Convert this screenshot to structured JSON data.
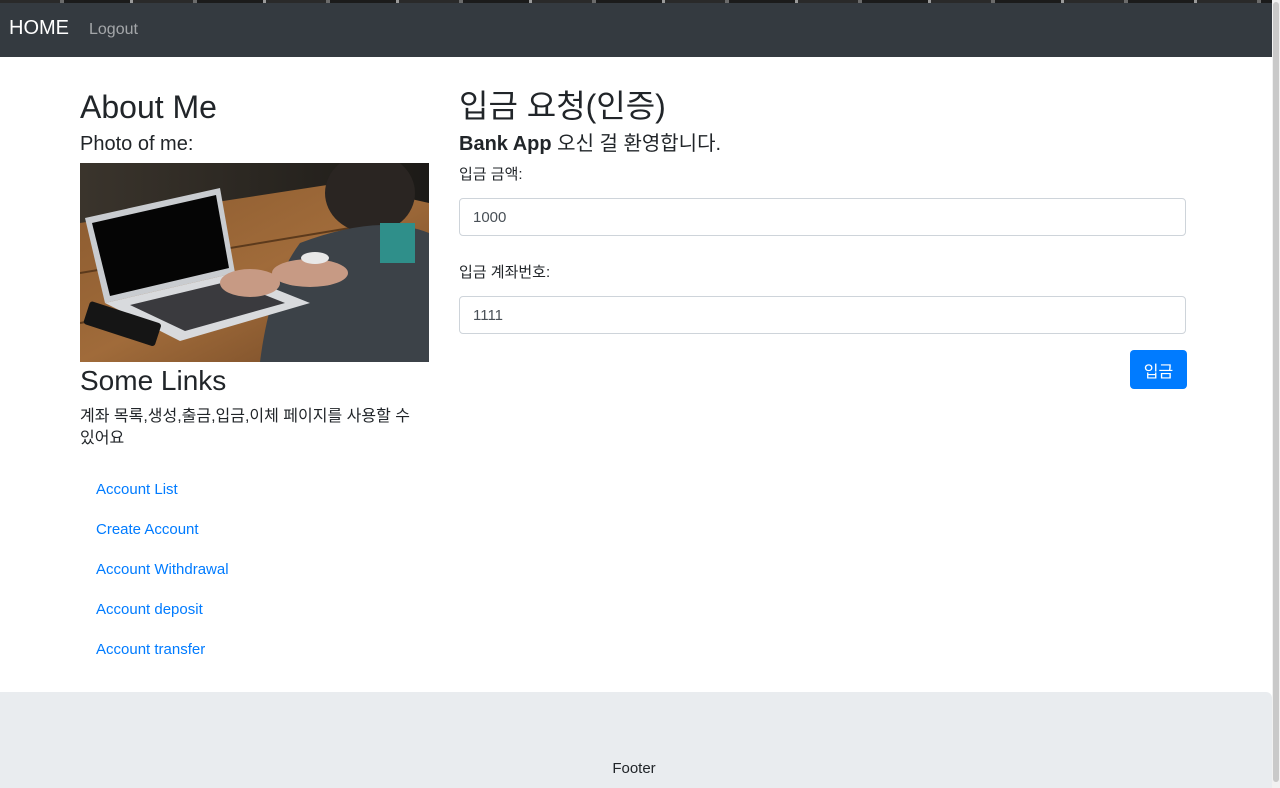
{
  "navbar": {
    "brand": "HOME",
    "links": [
      {
        "label": "Logout"
      }
    ]
  },
  "sidebar": {
    "title": "About Me",
    "photo_label": "Photo of me:",
    "photo_icon": "laptop-photo",
    "links_title": "Some Links",
    "links_description": "계좌 목록,생성,출금,입금,이체 페이지를 사용할 수 있어요",
    "links": [
      {
        "label": "Account List"
      },
      {
        "label": "Create Account"
      },
      {
        "label": "Account Withdrawal"
      },
      {
        "label": "Account deposit"
      },
      {
        "label": "Account transfer"
      }
    ]
  },
  "main": {
    "title": "입금 요청(인증)",
    "welcome_bold": "Bank App",
    "welcome_rest": " 오신 걸 환영합니다.",
    "fields": [
      {
        "label": "입금 금액:",
        "value": "1000"
      },
      {
        "label": "입금 계좌번호:",
        "value": "1111"
      }
    ],
    "submit_label": "입금"
  },
  "footer": {
    "text": "Footer"
  },
  "colors": {
    "navbar_bg": "#343a40",
    "primary": "#007bff",
    "footer_bg": "#e9ecef",
    "link": "#007bff"
  }
}
